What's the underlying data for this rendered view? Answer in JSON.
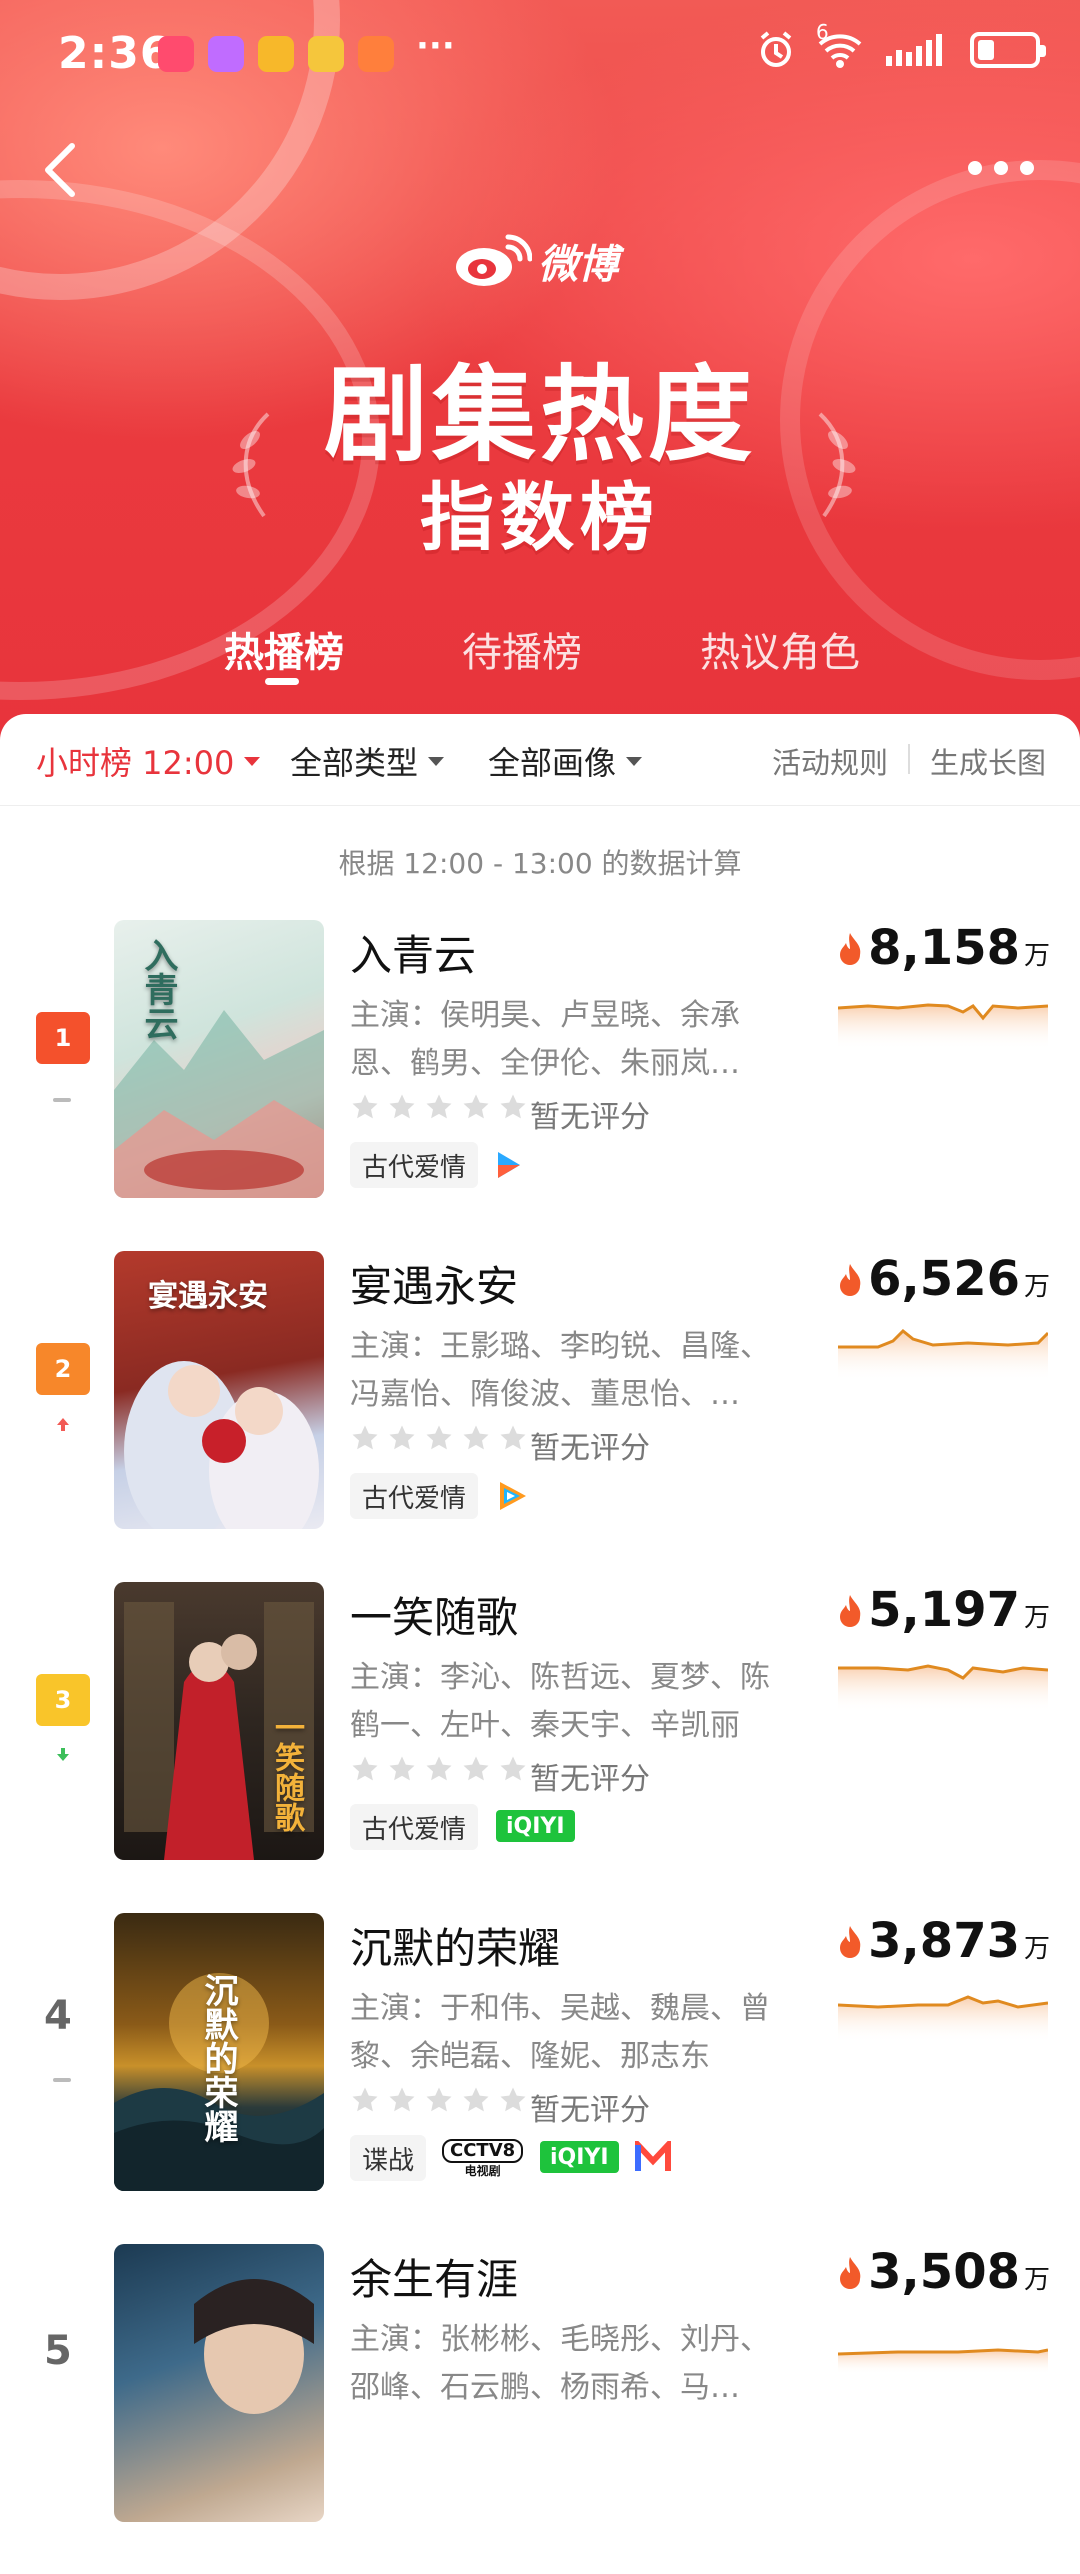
{
  "status_bar": {
    "time": "2:36",
    "overflow": "···",
    "network_label": "6"
  },
  "header": {
    "logo_text": "微博",
    "title_line1": "剧集热度",
    "title_line2": "指数榜"
  },
  "tabs": [
    {
      "label": "热播榜",
      "active": true
    },
    {
      "label": "待播榜",
      "active": false
    },
    {
      "label": "热议角色",
      "active": false
    }
  ],
  "filters": {
    "time": "小时榜 12:00",
    "type": "全部类型",
    "image": "全部画像",
    "rules": "活动规则",
    "long_image": "生成长图"
  },
  "calc_note": "根据 12:00 - 13:00 的数据计算",
  "ratings_text": "暂无评分",
  "unit": "万",
  "colors": {
    "brand_red": "#e8343c",
    "flame": "#f25a2a",
    "spark": "#e08a20"
  },
  "list": [
    {
      "rank": "1",
      "title": "入青云",
      "cast_line1": "主演：侯明昊、卢昱晓、余承",
      "cast_line2": "恩、鹤男、全伊伦、朱丽岚…",
      "genre": "古代爱情",
      "platforms": [
        "youku-icon"
      ],
      "heat": "8,158",
      "trend": "flat",
      "badge_color": "#f4512c",
      "poster_title": "入青云"
    },
    {
      "rank": "2",
      "title": "宴遇永安",
      "cast_line1": "主演：王影璐、李昀锐、昌隆、",
      "cast_line2": "冯嘉怡、隋俊波、董思怡、…",
      "genre": "古代爱情",
      "platforms": [
        "tencent-video-icon"
      ],
      "heat": "6,526",
      "trend": "up",
      "badge_color": "#f7872a",
      "poster_title": "宴遇永安"
    },
    {
      "rank": "3",
      "title": "一笑随歌",
      "cast_line1": "主演：李沁、陈哲远、夏梦、陈",
      "cast_line2": "鹤一、左叶、秦天宇、辛凯丽",
      "genre": "古代爱情",
      "platforms": [
        "iQIYI"
      ],
      "heat": "5,197",
      "trend": "down",
      "badge_color": "#f9c52a",
      "poster_title": "一笑随歌"
    },
    {
      "rank": "4",
      "title": "沉默的荣耀",
      "cast_line1": "主演：于和伟、吴越、魏晨、曾",
      "cast_line2": "黎、余皑磊、隆妮、那志东",
      "genre": "谍战",
      "platforms": [
        "CCTV8",
        "电视剧",
        "iQIYI",
        "mango-tv-icon"
      ],
      "heat": "3,873",
      "trend": "flat",
      "poster_title": "沉默的荣耀"
    },
    {
      "rank": "5",
      "title": "余生有涯",
      "cast_line1": "主演：张彬彬、毛晓彤、刘丹、",
      "cast_line2": "邵峰、石云鹏、杨雨希、马…",
      "heat": "3,508",
      "trend": "flat",
      "poster_title": ""
    }
  ]
}
